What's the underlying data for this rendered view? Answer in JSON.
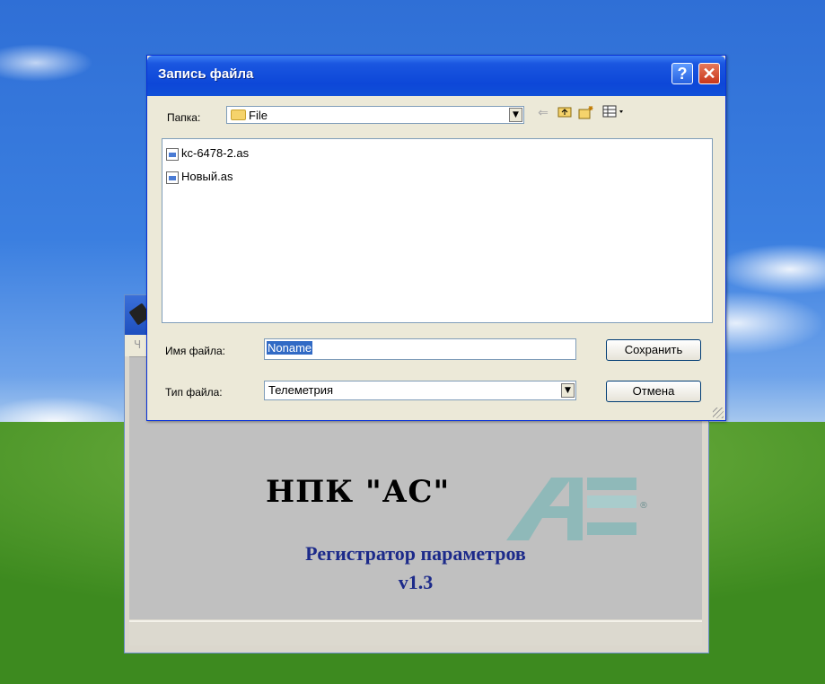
{
  "background_window": {
    "menu_stub": "Ч",
    "company": "НПК \"АС\"",
    "logo_mark": "®",
    "product_line1": "Регистратор параметров",
    "product_line2": "v1.3"
  },
  "dialog": {
    "title": "Запись файла",
    "help_button": "?",
    "close_button": "✕",
    "folder_label": "Папка:",
    "folder_value": "File",
    "toolbar_icons": [
      "back-arrow-icon",
      "up-folder-icon",
      "new-folder-icon",
      "view-menu-icon"
    ],
    "files": [
      {
        "name": "kc-6478-2.as"
      },
      {
        "name": "Новый.as"
      }
    ],
    "filename_label": "Имя файла:",
    "filename_value": "Noname",
    "filetype_label": "Тип файла:",
    "filetype_value": "Телеметрия",
    "save_button": "Сохранить",
    "cancel_button": "Отмена"
  },
  "colors": {
    "title_bar": "#0d47d8",
    "dialog_face": "#ece9d8",
    "selection": "#316ac5",
    "product_text": "#1c2a8a"
  }
}
